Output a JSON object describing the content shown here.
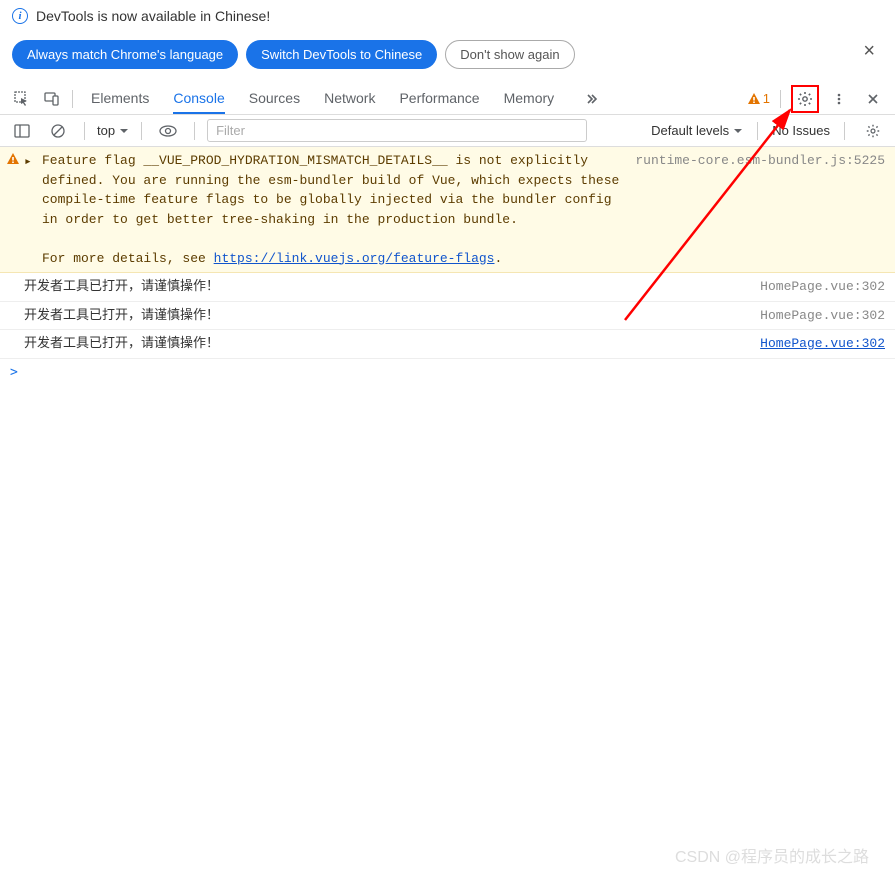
{
  "infobar": {
    "text": "DevTools is now available in Chinese!",
    "btn_match": "Always match Chrome's language",
    "btn_switch": "Switch DevTools to Chinese",
    "btn_dismiss": "Don't show again"
  },
  "tabs": {
    "elements": "Elements",
    "console": "Console",
    "sources": "Sources",
    "network": "Network",
    "performance": "Performance",
    "memory": "Memory"
  },
  "warn_count": "1",
  "toolbar": {
    "context": "top",
    "filter_placeholder": "Filter",
    "levels": "Default levels",
    "issues": "No Issues"
  },
  "console": {
    "warn_line1": "Feature flag __VUE_PROD_HYDRATION_MISMATCH_DETAILS__ is not",
    "warn_line2": "explicitly defined. You are running the esm-bundler build of Vue, which expects these compile-time feature flags to be globally injected via the bundler config in order to get better tree-shaking in the production bundle.",
    "warn_line3": "For more details, see ",
    "warn_link": "https://link.vuejs.org/feature-flags",
    "warn_suffix": ".",
    "warn_src": "runtime-core.esm-bundler.js:5225",
    "log_text": "开发者工具已打开，请谨慎操作！",
    "log_src": "HomePage.vue:302",
    "prompt": ">"
  },
  "watermark": "CSDN @程序员的成长之路"
}
